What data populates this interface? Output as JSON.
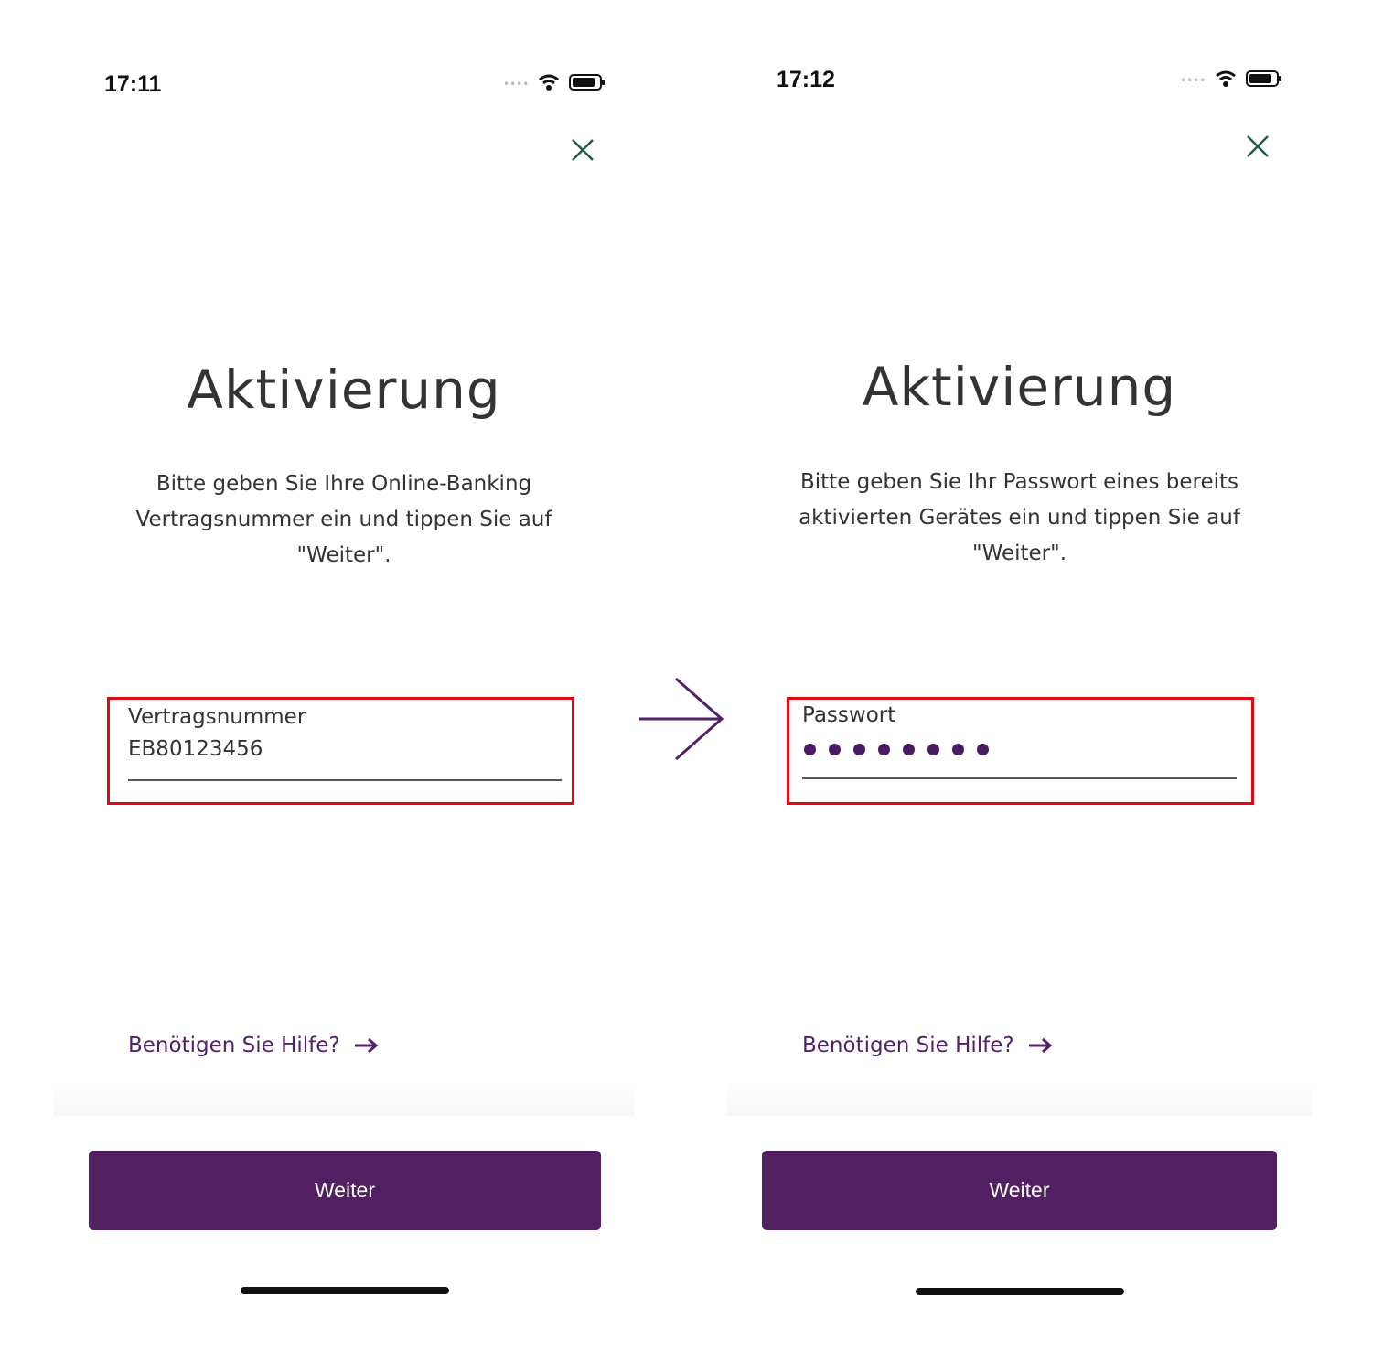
{
  "screens": [
    {
      "time": "17:11",
      "title": "Aktivierung",
      "description": [
        "Bitte geben Sie Ihre Online-Banking",
        "Vertragsnummer ein und tippen Sie auf",
        "\"Weiter\"."
      ],
      "field": {
        "label": "Vertragsnummer",
        "value": "EB80123456"
      },
      "help_link": "Benötigen Sie Hilfe?",
      "button": "Weiter"
    },
    {
      "time": "17:12",
      "title": "Aktivierung",
      "description": [
        "Bitte geben Sie Ihr Passwort eines bereits",
        "aktivierten Gerätes ein und tippen Sie auf",
        "\"Weiter\"."
      ],
      "field": {
        "label": "Passwort",
        "masked_length": 8
      },
      "help_link": "Benötigen Sie Hilfe?",
      "button": "Weiter"
    }
  ],
  "icons": {
    "close": "close-icon",
    "help_arrow": "arrow-right-icon",
    "flow_arrow": "arrow-right-icon",
    "wifi": "wifi-icon",
    "battery": "battery-icon"
  },
  "colors": {
    "brand_purple": "#521f62",
    "highlight_red": "#e30613",
    "close_icon": "#1f5a4a",
    "text": "#333333"
  }
}
